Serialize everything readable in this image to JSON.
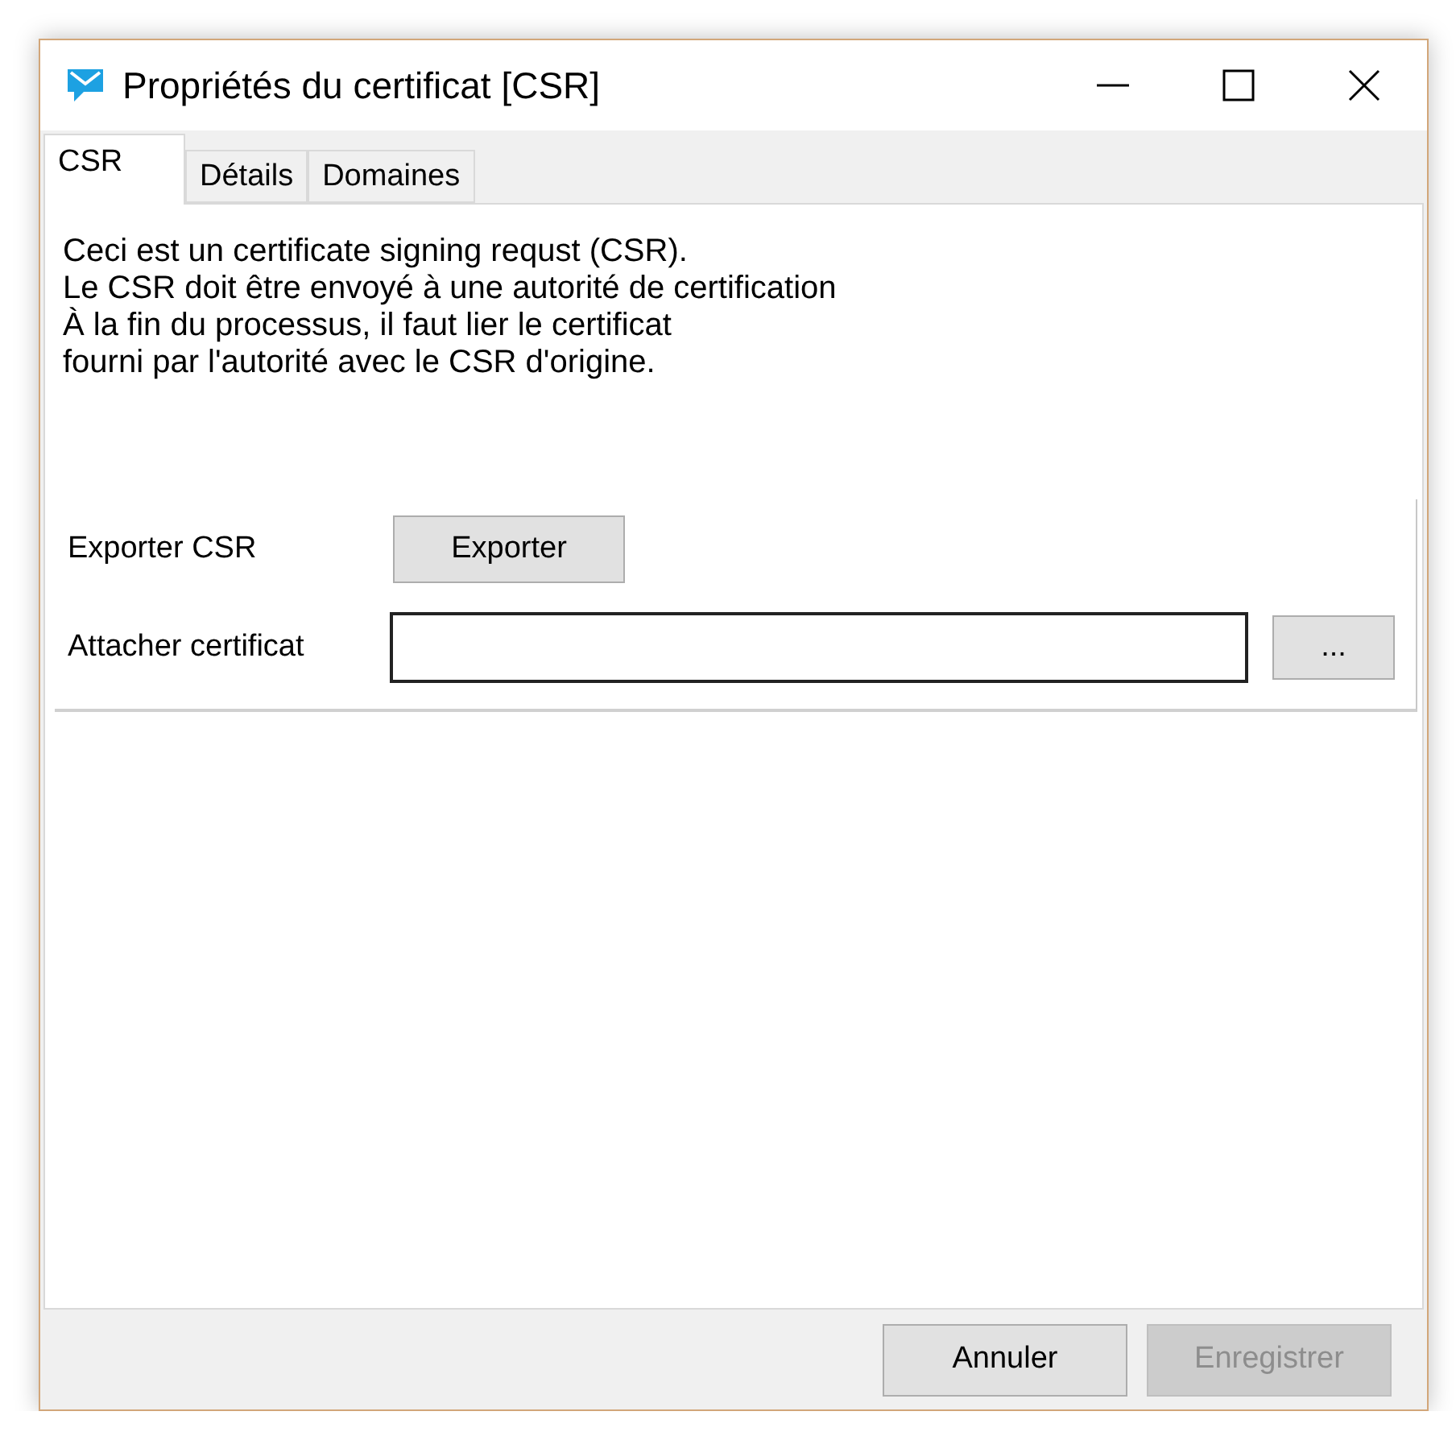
{
  "window": {
    "title": "Propriétés du certificat [CSR]"
  },
  "tabs": [
    {
      "label": "CSR",
      "selected": true
    },
    {
      "label": "Détails",
      "selected": false
    },
    {
      "label": "Domaines",
      "selected": false
    }
  ],
  "description": [
    "Ceci est un certificate signing requst (CSR).",
    "Le CSR doit être envoyé à une autorité de certification",
    "À la fin du processus, il faut lier le certificat",
    "fourni par l'autorité avec le CSR d'origine."
  ],
  "export_row": {
    "label": "Exporter CSR",
    "button": "Exporter"
  },
  "attach_row": {
    "label": "Attacher certificat",
    "browse_button": "..."
  },
  "buttons": [
    {
      "label": "Annuler",
      "disabled": false
    },
    {
      "label": "Enregistrer",
      "disabled": true
    }
  ]
}
